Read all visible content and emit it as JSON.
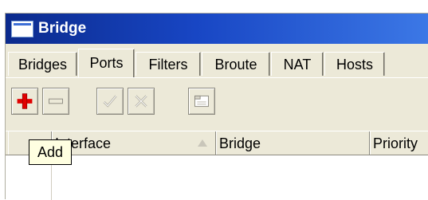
{
  "window": {
    "title": "Bridge",
    "titlebar_color": "#1846c4"
  },
  "tabs": [
    {
      "label": "Bridges",
      "active": false
    },
    {
      "label": "Ports",
      "active": true
    },
    {
      "label": "Filters",
      "active": false
    },
    {
      "label": "Broute",
      "active": false
    },
    {
      "label": "NAT",
      "active": false
    },
    {
      "label": "Hosts",
      "active": false
    }
  ],
  "toolbar": {
    "buttons": [
      {
        "name": "add",
        "icon": "plus-icon",
        "color": "#e00000"
      },
      {
        "name": "remove",
        "icon": "minus-icon"
      },
      {
        "name": "enable",
        "icon": "check-icon"
      },
      {
        "name": "disable",
        "icon": "x-icon"
      },
      {
        "name": "comment",
        "icon": "note-icon"
      }
    ]
  },
  "table": {
    "columns": [
      {
        "label": ""
      },
      {
        "label": "Interface",
        "sorted": true
      },
      {
        "label": "Bridge"
      },
      {
        "label": "Priority"
      }
    ]
  },
  "tooltip": {
    "text": "Add"
  }
}
